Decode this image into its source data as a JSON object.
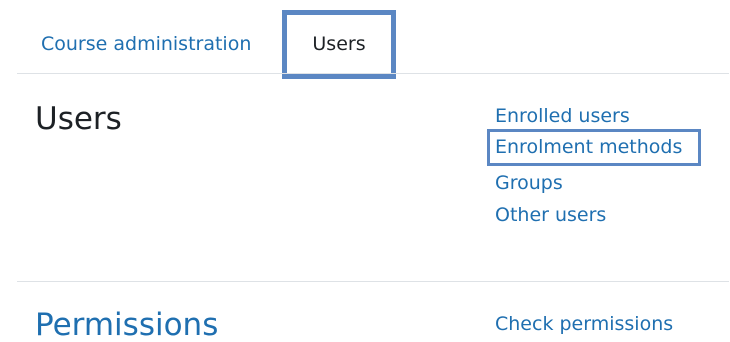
{
  "tabs": {
    "course_administration": "Course administration",
    "users": "Users"
  },
  "sections": {
    "users": {
      "title": "Users",
      "links": {
        "enrolled_users": "Enrolled users",
        "enrolment_methods": "Enrolment methods",
        "groups": "Groups",
        "other_users": "Other users"
      }
    },
    "permissions": {
      "title": "Permissions",
      "links": {
        "check_permissions": "Check permissions"
      }
    }
  },
  "colors": {
    "link": "#1f6fb0",
    "text": "#1d2125",
    "highlight_border": "#5b87c3",
    "divider": "#dee2e6"
  }
}
